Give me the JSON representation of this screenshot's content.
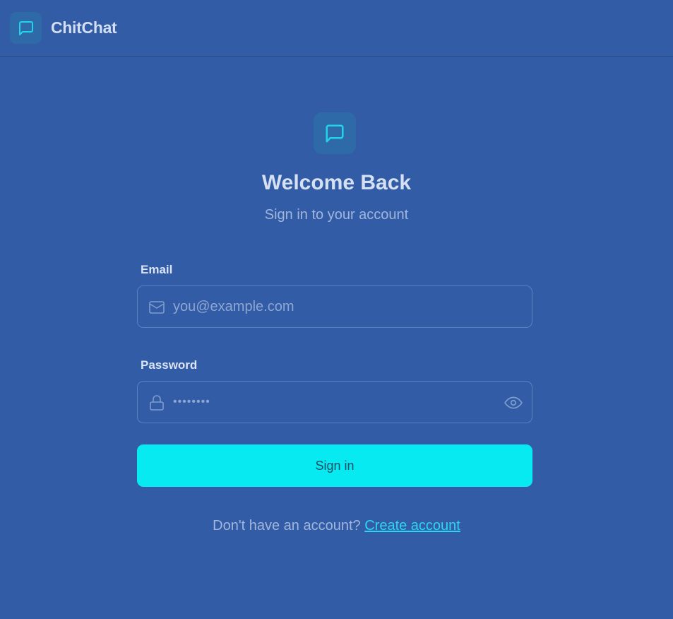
{
  "app": {
    "name": "ChitChat",
    "logo_icon": "chat-bubble-icon"
  },
  "login": {
    "title": "Welcome Back",
    "subtitle": "Sign in to your account",
    "email": {
      "label": "Email",
      "placeholder": "you@example.com",
      "value": "",
      "icon": "mail-icon"
    },
    "password": {
      "label": "Password",
      "masked_value": "••••••••",
      "icon": "lock-icon",
      "toggle_icon": "eye-icon"
    },
    "submit_label": "Sign in",
    "footer_prompt": "Don't have an account?",
    "footer_link": "Create account"
  },
  "colors": {
    "background": "#325ca5",
    "accent": "#08eaf2",
    "link": "#2dd6ef",
    "logo_tile": "#2f6aa8"
  }
}
